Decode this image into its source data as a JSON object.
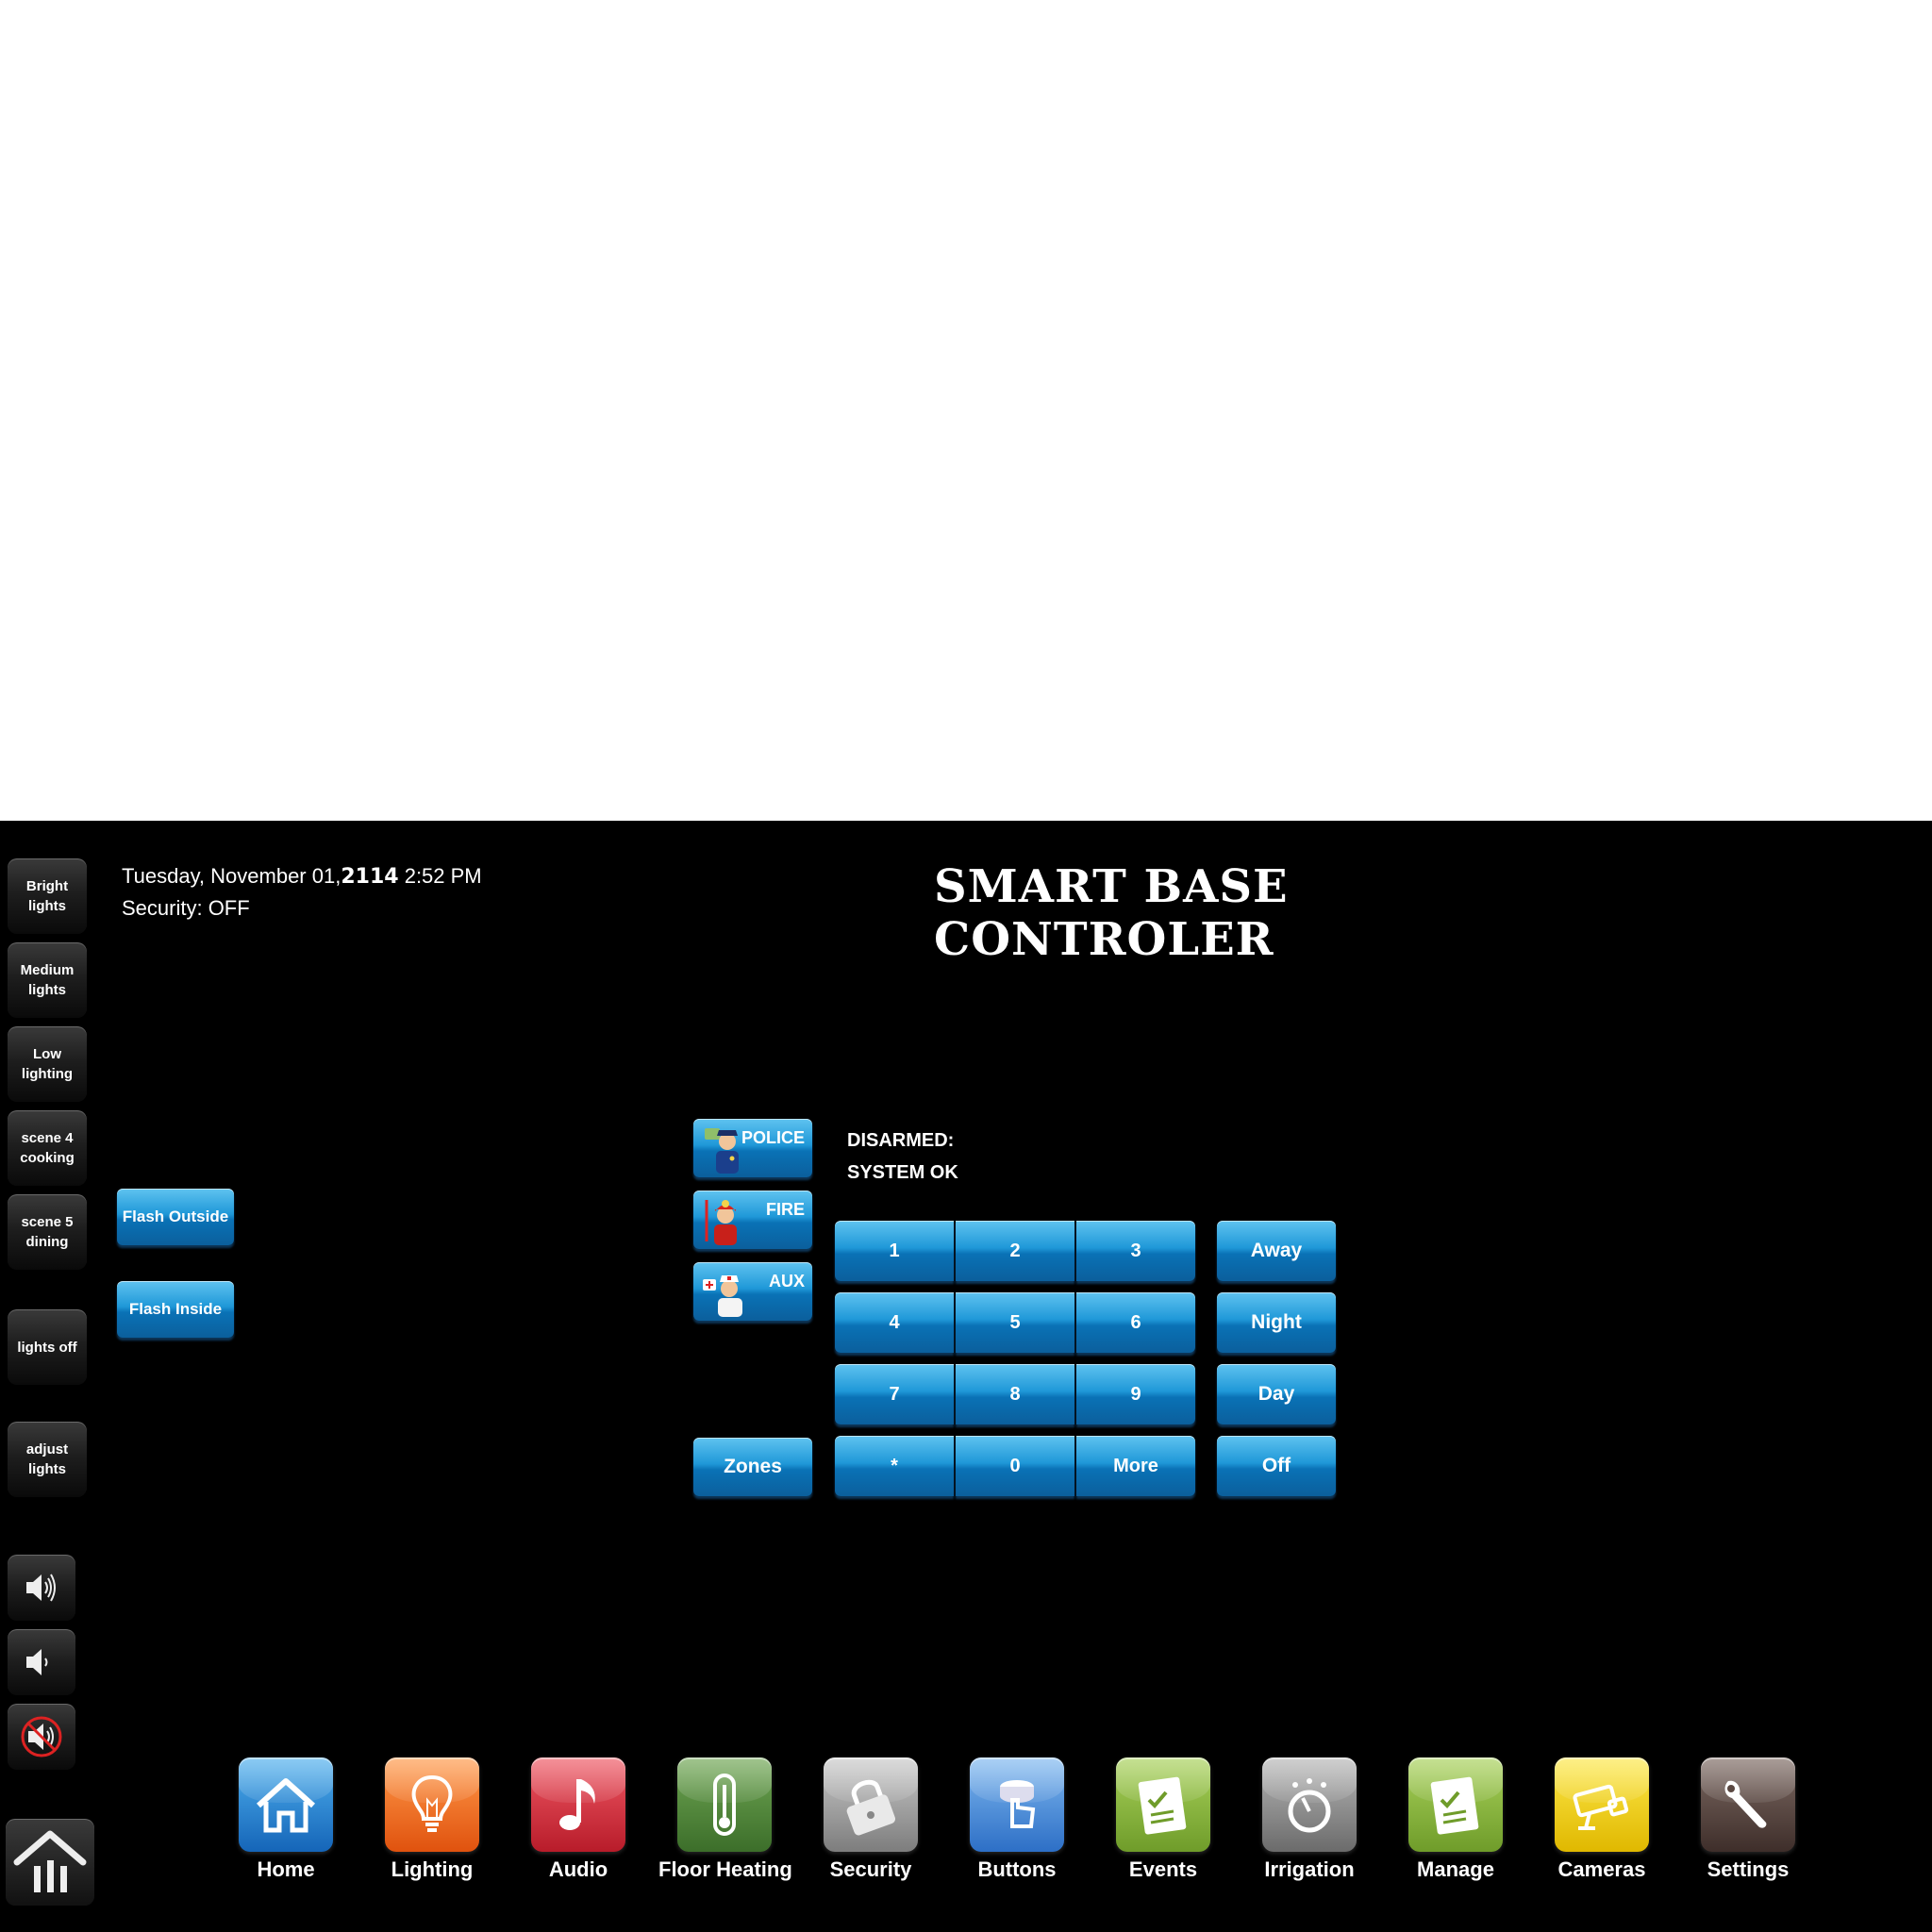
{
  "header": {
    "date_prefix": "Tuesday, November 01,",
    "year": "2114",
    "time": "2:52 PM",
    "security_status": "Security: OFF",
    "title": "SMART BASE CONTROLER"
  },
  "scenes": [
    {
      "label": "Bright\nlights"
    },
    {
      "label": "Medium\nlights"
    },
    {
      "label": "Low\nlighting"
    },
    {
      "label": "scene 4\ncooking"
    },
    {
      "label": "scene 5\ndining"
    },
    {
      "label": "lights off"
    },
    {
      "label": "adjust\nlights"
    }
  ],
  "volume": {
    "up_icon": "volume-up-icon",
    "down_icon": "volume-down-icon",
    "mute_icon": "volume-mute-icon"
  },
  "flash": {
    "outside": "Flash Outside",
    "inside": "Flash Inside"
  },
  "emergency": {
    "police": "POLICE",
    "fire": "FIRE",
    "aux": "AUX",
    "zones": "Zones"
  },
  "alarm_status": {
    "line1": "DISARMED:",
    "line2": "SYSTEM OK"
  },
  "keypad": {
    "rows": [
      [
        "1",
        "2",
        "3"
      ],
      [
        "4",
        "5",
        "6"
      ],
      [
        "7",
        "8",
        "9"
      ],
      [
        "*",
        "0",
        "More"
      ]
    ]
  },
  "arm_modes": [
    "Away",
    "Night",
    "Day",
    "Off"
  ],
  "nav": [
    {
      "label": "Home",
      "icon": "home-icon",
      "color": "#1e88d6"
    },
    {
      "label": "Lighting",
      "icon": "lightbulb-icon",
      "color": "#f26a1b"
    },
    {
      "label": "Audio",
      "icon": "music-note-icon",
      "color": "#d42a36"
    },
    {
      "label": "Floor Heating",
      "icon": "thermometer-icon",
      "color": "#4f8a3a"
    },
    {
      "label": "Security",
      "icon": "padlock-icon",
      "color": "#9a9a9a"
    },
    {
      "label": "Buttons",
      "icon": "button-press-icon",
      "color": "#3f86d8"
    },
    {
      "label": "Events",
      "icon": "checklist-icon",
      "color": "#8dbb3a"
    },
    {
      "label": "Irrigation",
      "icon": "sprinkler-icon",
      "color": "#8e8e8e"
    },
    {
      "label": "Manage",
      "icon": "checklist-icon",
      "color": "#8dbb3a"
    },
    {
      "label": "Cameras",
      "icon": "camera-icon",
      "color": "#f5d20a"
    },
    {
      "label": "Settings",
      "icon": "wrench-icon",
      "color": "#5e4a44"
    }
  ]
}
